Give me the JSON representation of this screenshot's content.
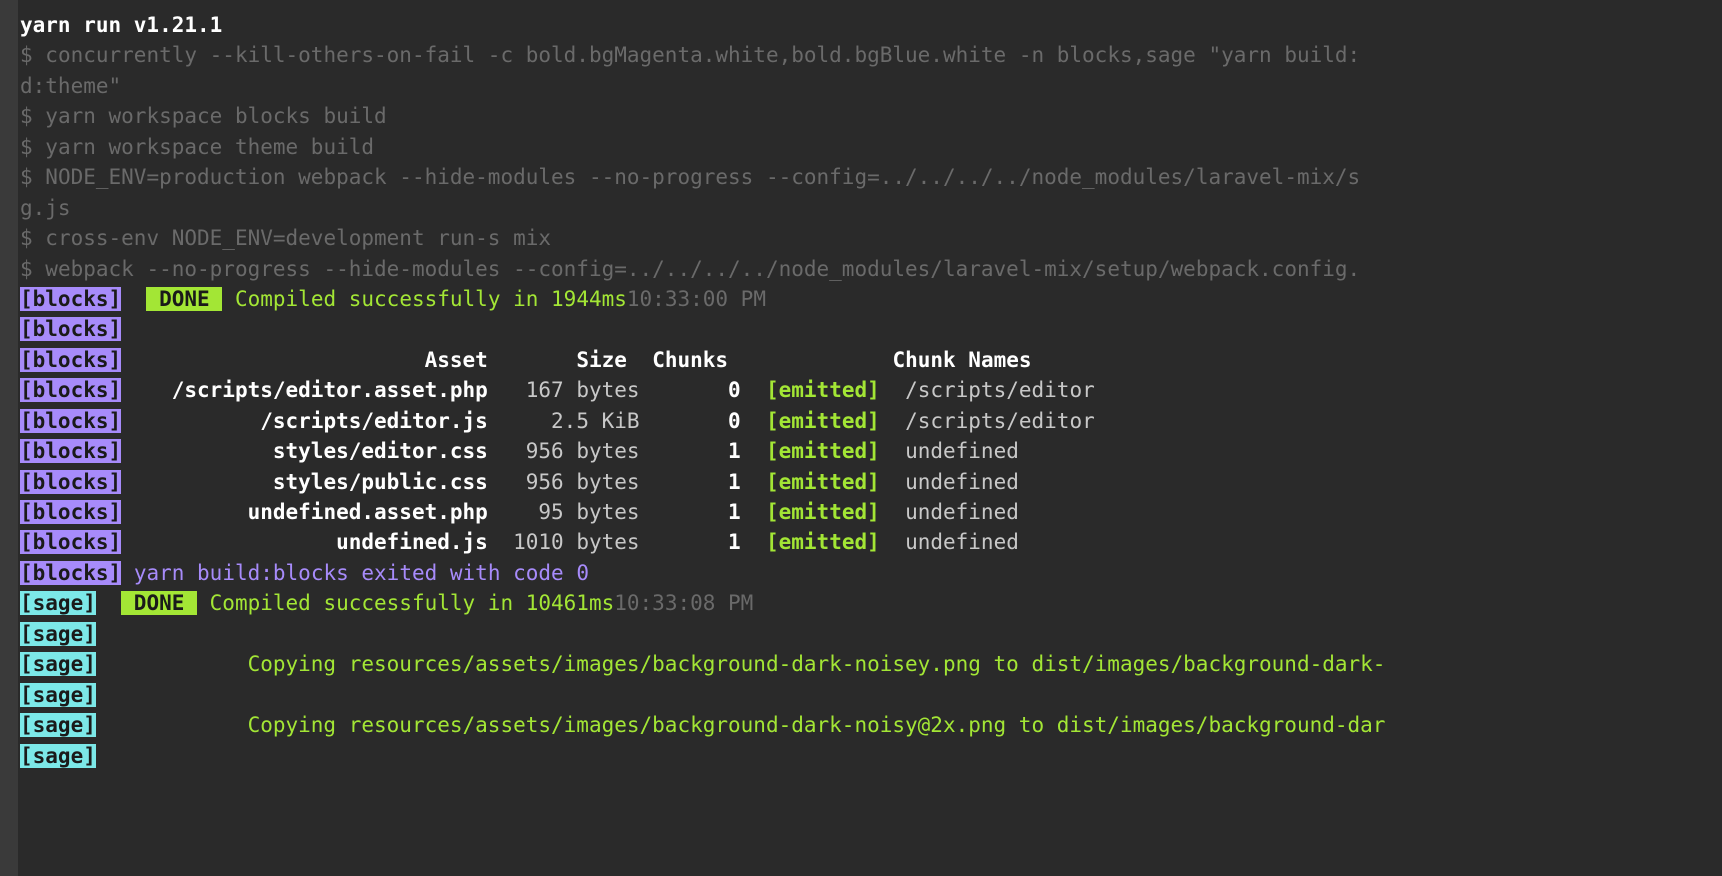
{
  "header": "yarn run v1.21.1",
  "cmd1_prefix": "$ ",
  "cmd1": "concurrently --kill-others-on-fail -c bold.bgMagenta.white,bold.bgBlue.white -n blocks,sage \"yarn build:",
  "cmd1_wrap": "d:theme\"",
  "cmd2_prefix": "$ ",
  "cmd2": "yarn workspace blocks build",
  "cmd3_prefix": "$ ",
  "cmd3": "yarn workspace theme build",
  "cmd4_prefix": "$ ",
  "cmd4": "NODE_ENV=production webpack --hide-modules --no-progress --config=../../../../node_modules/laravel-mix/s",
  "cmd4_wrap": "g.js",
  "cmd5_prefix": "$ ",
  "cmd5": "cross-env NODE_ENV=development run-s mix",
  "cmd6_prefix": "$ ",
  "cmd6": "webpack --no-progress --hide-modules --config=../../../../node_modules/laravel-mix/setup/webpack.config.",
  "blocks_tag": "[blocks]",
  "sage_tag": "[sage]",
  "done_tag": " DONE ",
  "blocks_done": " Compiled successfully in 1944ms",
  "blocks_time": "10:33:00 PM",
  "sage_done": " Compiled successfully in 10461ms",
  "sage_time": "10:33:08 PM",
  "th_asset": "Asset",
  "th_size": "Size",
  "th_chunks": "Chunks",
  "th_chunknames": "Chunk Names",
  "assets": [
    {
      "name": "/scripts/editor.asset.php",
      "size": "167 bytes",
      "chunks": "0",
      "status": "[emitted]",
      "chunkname": "/scripts/editor"
    },
    {
      "name": "/scripts/editor.js",
      "size": "2.5 KiB",
      "chunks": "0",
      "status": "[emitted]",
      "chunkname": "/scripts/editor"
    },
    {
      "name": "styles/editor.css",
      "size": "956 bytes",
      "chunks": "1",
      "status": "[emitted]",
      "chunkname": "undefined"
    },
    {
      "name": "styles/public.css",
      "size": "956 bytes",
      "chunks": "1",
      "status": "[emitted]",
      "chunkname": "undefined"
    },
    {
      "name": "undefined.asset.php",
      "size": "95 bytes",
      "chunks": "1",
      "status": "[emitted]",
      "chunkname": "undefined"
    },
    {
      "name": "undefined.js",
      "size": "1010 bytes",
      "chunks": "1",
      "status": "[emitted]",
      "chunkname": "undefined"
    }
  ],
  "blocks_exit": "yarn build:blocks exited with code 0",
  "copy1": "Copying resources/assets/images/background-dark-noisey.png to dist/images/background-dark-",
  "copy2": "Copying resources/assets/images/background-dark-noisy@2x.png to dist/images/background-dar"
}
